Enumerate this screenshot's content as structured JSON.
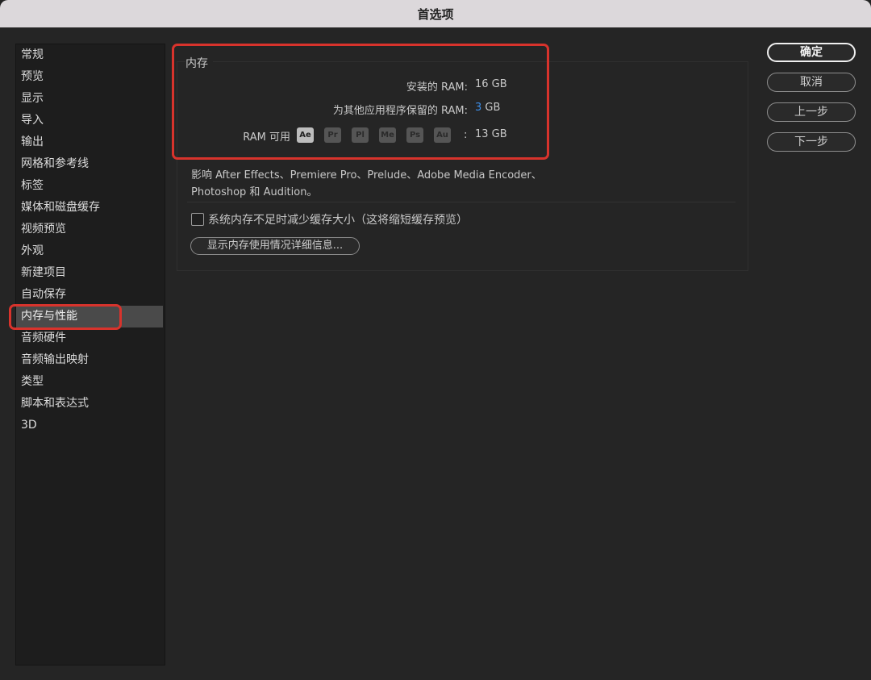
{
  "window": {
    "title": "首选项"
  },
  "sidebar": {
    "items": [
      {
        "label": "常规"
      },
      {
        "label": "预览"
      },
      {
        "label": "显示"
      },
      {
        "label": "导入"
      },
      {
        "label": "输出"
      },
      {
        "label": "网格和参考线"
      },
      {
        "label": "标签"
      },
      {
        "label": "媒体和磁盘缓存"
      },
      {
        "label": "视频预览"
      },
      {
        "label": "外观"
      },
      {
        "label": "新建项目"
      },
      {
        "label": "自动保存"
      },
      {
        "label": "内存与性能",
        "selected": true
      },
      {
        "label": "音频硬件"
      },
      {
        "label": "音频输出映射"
      },
      {
        "label": "类型"
      },
      {
        "label": "脚本和表达式"
      },
      {
        "label": "3D"
      }
    ]
  },
  "memory": {
    "group_label": "内存",
    "installed_label": "安装的 RAM:",
    "installed_value": "16 GB",
    "reserved_label": "为其他应用程序保留的 RAM:",
    "reserved_number": "3",
    "reserved_unit": "GB",
    "available_label": "RAM 可用",
    "apps": [
      "Ae",
      "Pr",
      "Pl",
      "Me",
      "Ps",
      "Au"
    ],
    "available_colon": ":",
    "available_value": "13 GB",
    "affects_line1": "影响 After Effects、Premiere Pro、Prelude、Adobe Media Encoder、",
    "affects_line2": "Photoshop 和 Audition。",
    "reduce_cache_label": "系统内存不足时减少缓存大小（这将缩短缓存预览）",
    "reduce_cache_checked": false,
    "details_button": "显示内存使用情况详细信息..."
  },
  "buttons": {
    "ok": "确定",
    "cancel": "取消",
    "previous": "上一步",
    "next": "下一步"
  },
  "colors": {
    "highlight_box": "#d8332c",
    "reserved_value": "#3d8ee8"
  }
}
